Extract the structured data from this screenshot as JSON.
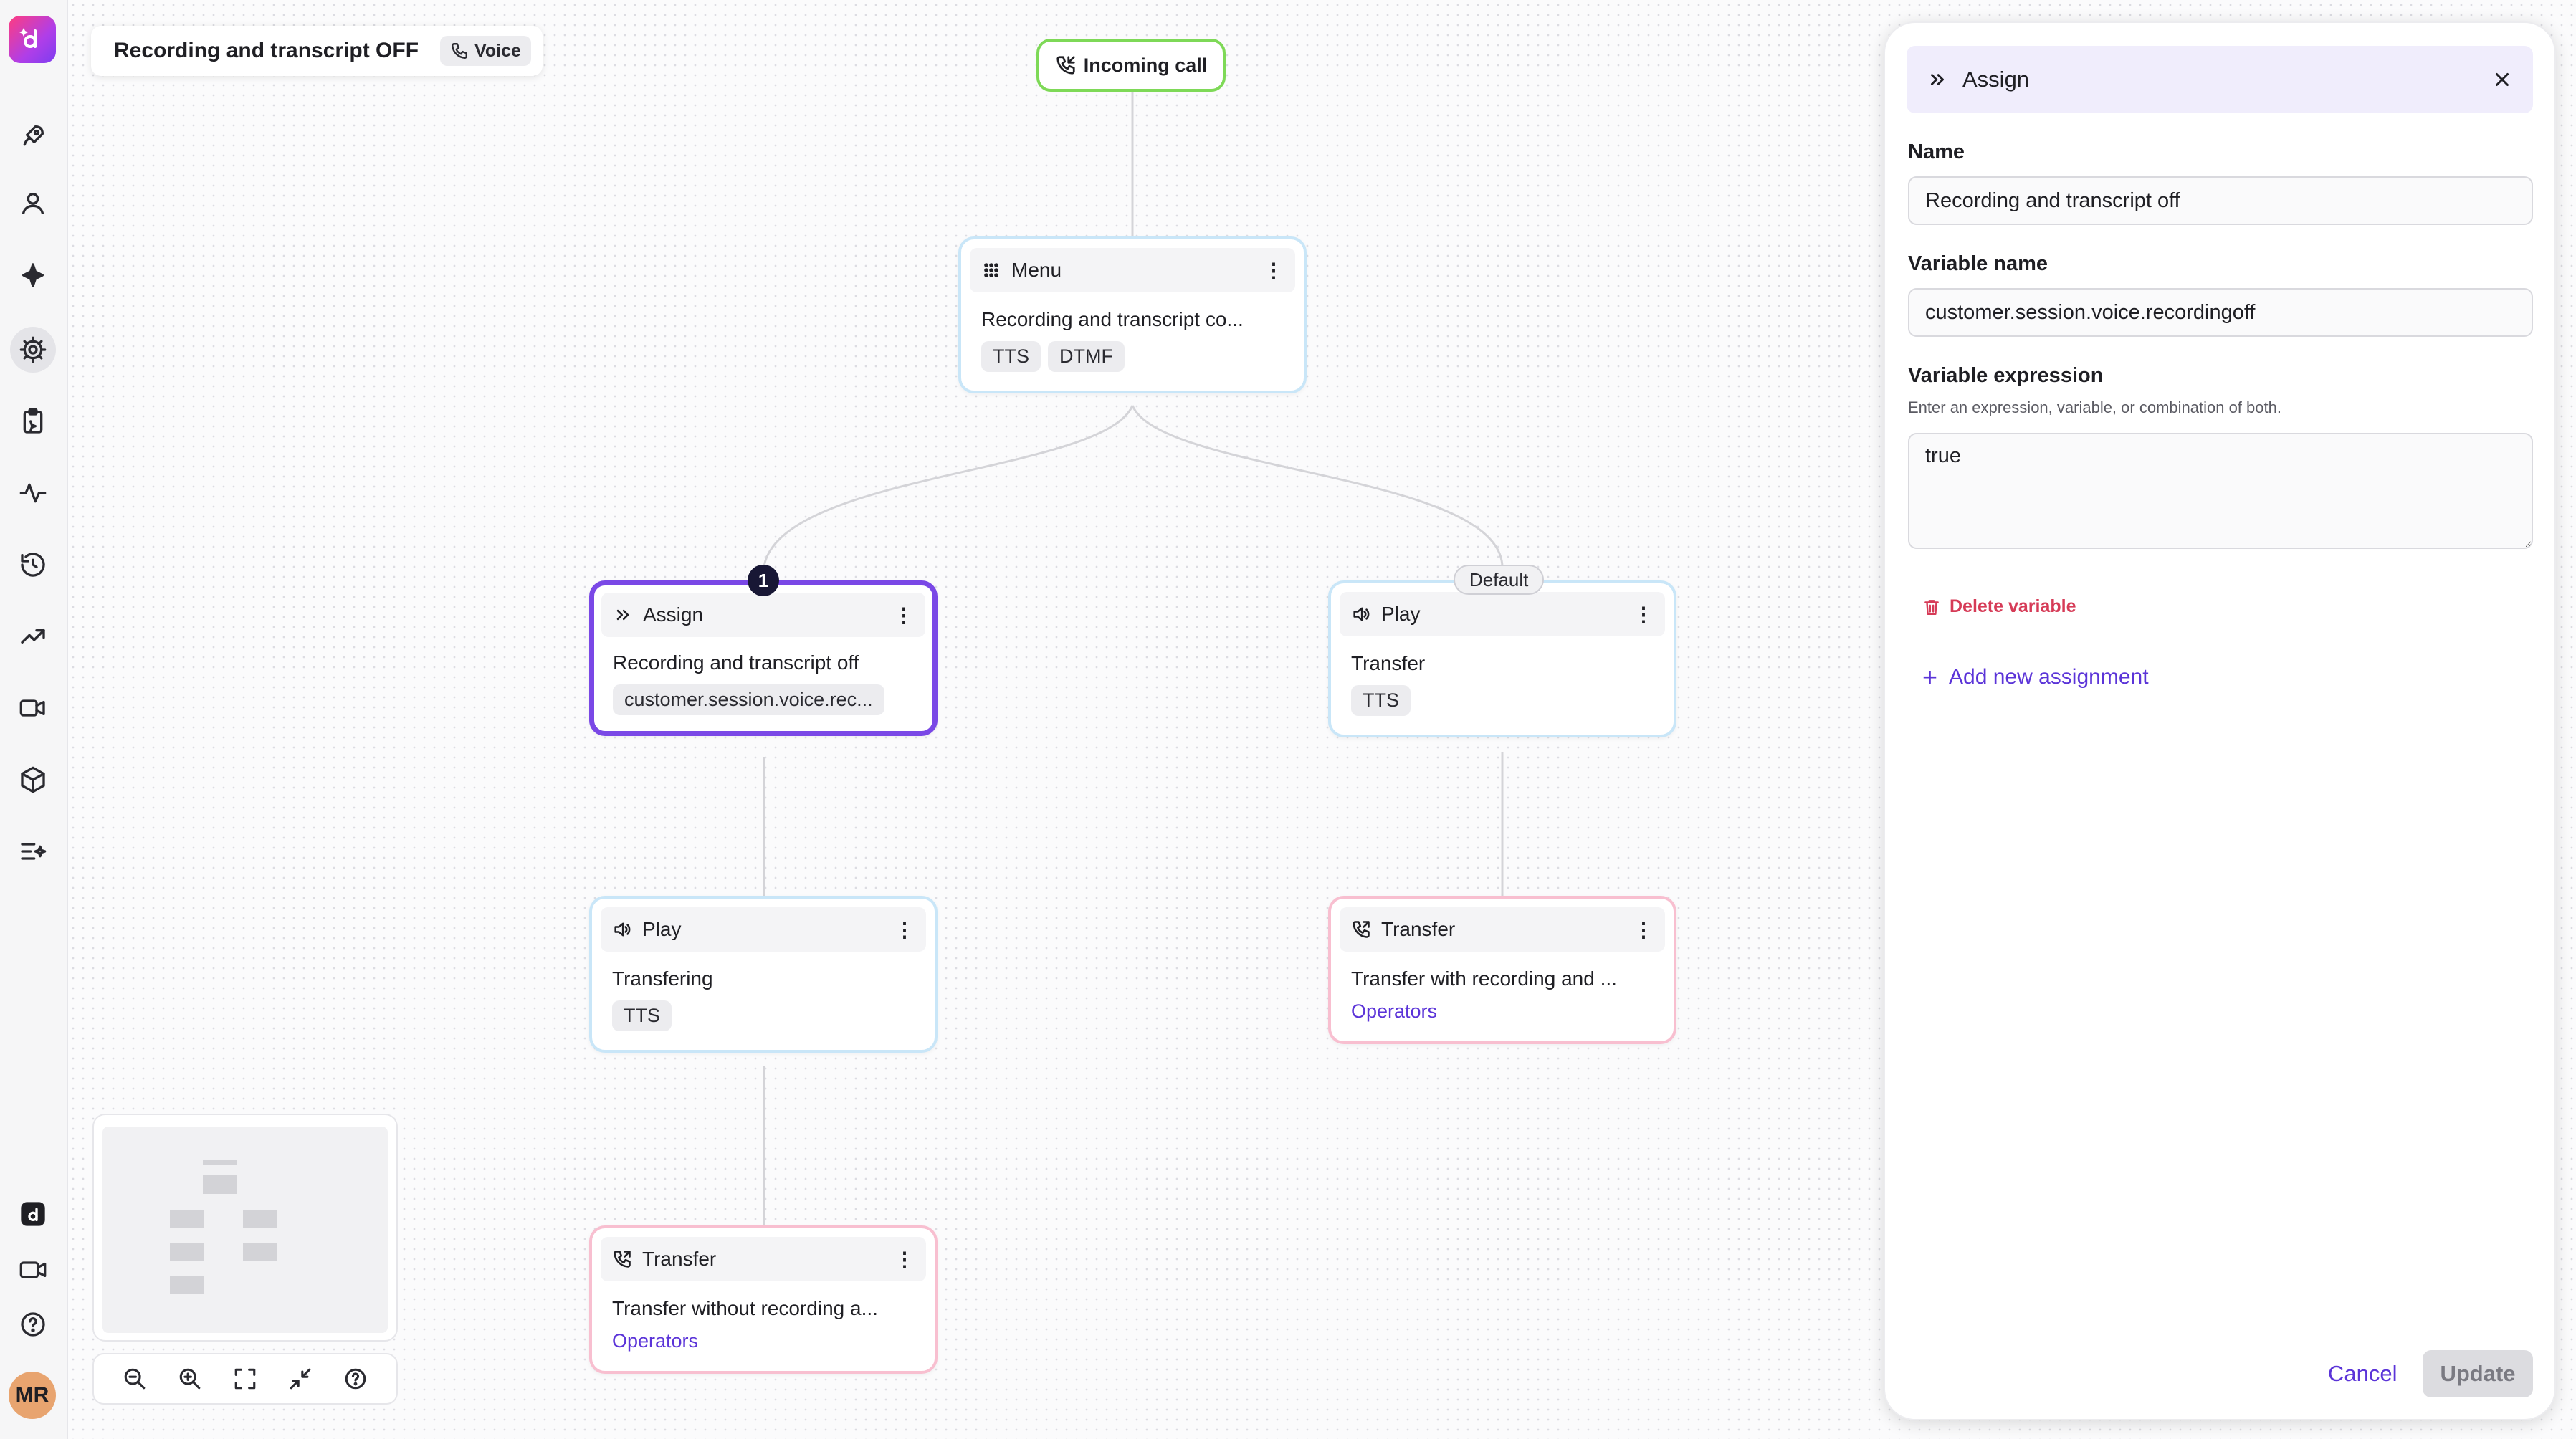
{
  "flow": {
    "title": "Recording and transcript OFF",
    "channel": "Voice"
  },
  "nodes": {
    "incoming": {
      "label": "Incoming call"
    },
    "menu": {
      "type": "Menu",
      "text": "Recording and transcript co...",
      "tags": [
        "TTS",
        "DTMF"
      ]
    },
    "assign": {
      "type": "Assign",
      "text": "Recording and transcript off",
      "tag": "customer.session.voice.rec...",
      "badge": "1"
    },
    "play_default": {
      "type": "Play",
      "text": "Transfer",
      "tag": "TTS",
      "branch_label": "Default"
    },
    "play_left": {
      "type": "Play",
      "text": "Transfering",
      "tag": "TTS"
    },
    "transfer_right": {
      "type": "Transfer",
      "text": "Transfer with recording and ...",
      "link": "Operators"
    },
    "transfer_left": {
      "type": "Transfer",
      "text": "Transfer without recording a...",
      "link": "Operators"
    }
  },
  "panel": {
    "title": "Assign",
    "name_label": "Name",
    "name_value": "Recording and transcript off",
    "varname_label": "Variable name",
    "varname_value": "customer.session.voice.recordingoff",
    "expr_label": "Variable expression",
    "expr_help": "Enter an expression, variable, or combination of both.",
    "expr_value": "true",
    "delete_label": "Delete variable",
    "add_label": "Add new assignment",
    "cancel_label": "Cancel",
    "update_label": "Update"
  },
  "user": {
    "initials": "MR"
  },
  "colors": {
    "accent": "#5b34d8",
    "selected_border": "#7a48e6",
    "start_border": "#7ed957",
    "node_border_blue": "#c9e6f8",
    "node_border_pink": "#f8bfd0",
    "danger": "#d63b57"
  }
}
